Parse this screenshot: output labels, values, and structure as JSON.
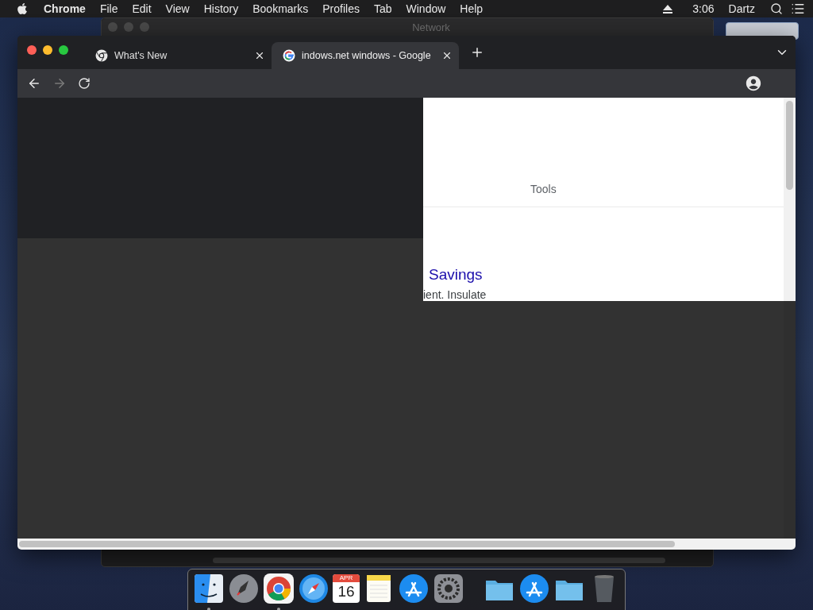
{
  "menu_bar": {
    "app": "Chrome",
    "items": [
      "File",
      "Edit",
      "View",
      "History",
      "Bookmarks",
      "Profiles",
      "Tab",
      "Window",
      "Help"
    ],
    "time": "3:06",
    "user": "Dartz"
  },
  "background_window": {
    "title": "Network"
  },
  "browser": {
    "tabs": [
      {
        "title": "What's New",
        "kind": "chrome",
        "selected": false
      },
      {
        "title": "indows.net windows - Google",
        "kind": "google",
        "selected": true
      }
    ],
    "forward_disabled": true,
    "page": {
      "tools_label": "Tools",
      "result_title": "Savings",
      "result_snippet": "ient. Insulate"
    }
  },
  "dock": {
    "items": [
      {
        "kind": "finder",
        "running": true
      },
      {
        "kind": "launchpad",
        "running": false
      },
      {
        "kind": "chrome",
        "running": true
      },
      {
        "kind": "safari",
        "running": false
      },
      {
        "kind": "calendar",
        "running": false,
        "month": "APR",
        "day": "16"
      },
      {
        "kind": "notes",
        "running": false
      },
      {
        "kind": "appstore",
        "running": false
      },
      {
        "kind": "settings",
        "running": false
      },
      {
        "kind": "separator"
      },
      {
        "kind": "folder",
        "running": false
      },
      {
        "kind": "appstore",
        "running": false
      },
      {
        "kind": "folder",
        "running": false
      },
      {
        "kind": "trash",
        "running": false
      }
    ]
  }
}
